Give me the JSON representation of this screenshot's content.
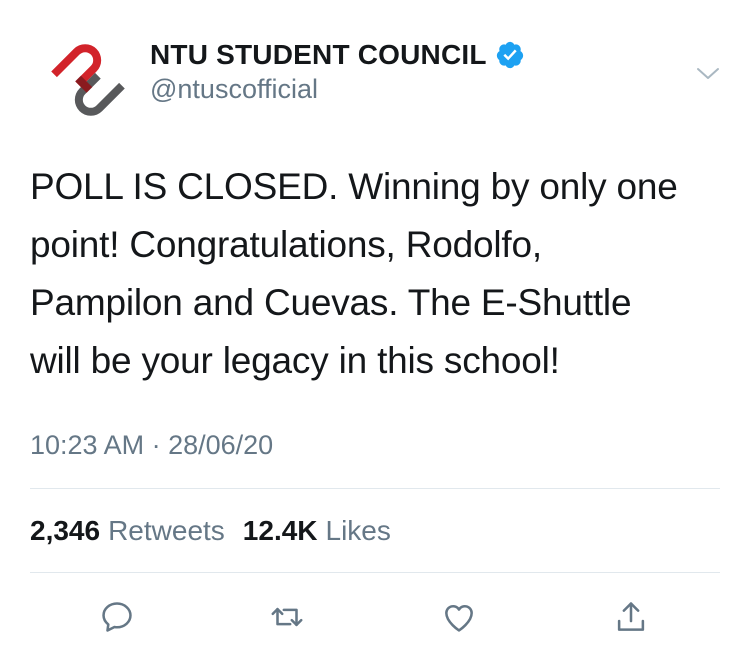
{
  "tweet": {
    "author": {
      "display_name": "NTU STUDENT COUNCIL",
      "handle": "@ntuscofficial",
      "verified": true,
      "avatar_icon": "ntu-logo-icon"
    },
    "text_lines": [
      "POLL IS CLOSED. Winning by only one",
      "point! Congratulations, Rodolfo,",
      "Pampilon and Cuevas. The E-Shuttle",
      "will be your legacy in this school!"
    ],
    "timestamp": "10:23 AM · 28/06/20",
    "stats": {
      "retweets_count": "2,346",
      "retweets_label": "Retweets",
      "likes_count": "12.4K",
      "likes_label": "Likes"
    },
    "actions": [
      "reply-icon",
      "retweet-icon",
      "like-icon",
      "share-icon"
    ]
  },
  "colors": {
    "text": "#14171a",
    "secondary": "#657786",
    "divider": "#e1e8ed",
    "verified_blue": "#1da1f2",
    "logo_red": "#d2232a",
    "logo_gray": "#58595b"
  }
}
